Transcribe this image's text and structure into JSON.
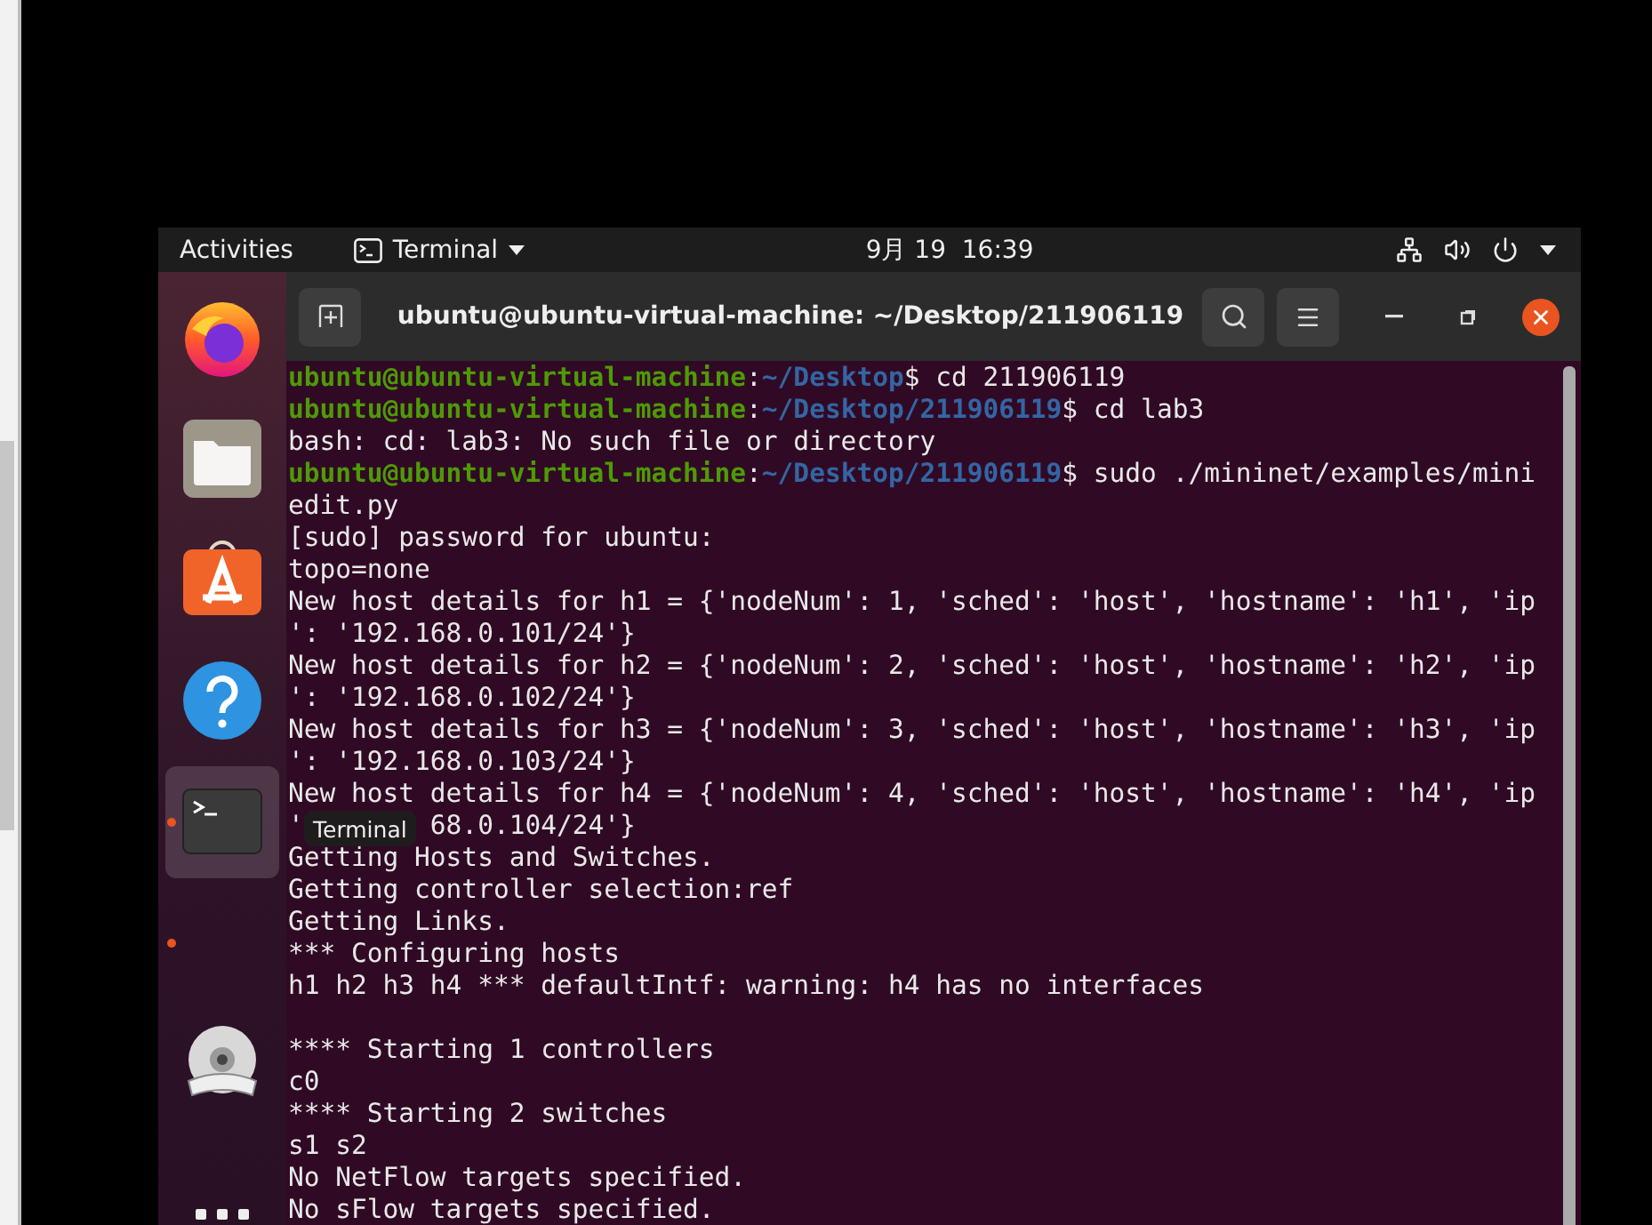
{
  "topbar": {
    "activities": "Activities",
    "app_menu": "Terminal",
    "clock": "9月 19  16:39"
  },
  "dock": {
    "items": [
      {
        "kind": "firefox",
        "running": false,
        "selected": false
      },
      {
        "kind": "files",
        "running": false,
        "selected": false
      },
      {
        "kind": "software",
        "running": false,
        "selected": false
      },
      {
        "kind": "help",
        "running": false,
        "selected": false
      },
      {
        "kind": "terminal",
        "running": true,
        "selected": true
      },
      {
        "kind": "empty",
        "running": true,
        "selected": false
      },
      {
        "kind": "dvd",
        "running": false,
        "selected": false
      }
    ],
    "tooltip": "Terminal"
  },
  "window": {
    "title": "ubuntu@ubuntu-virtual-machine: ~/Desktop/211906119"
  },
  "terminal": {
    "lines": [
      {
        "kind": "prompt",
        "user": "ubuntu@ubuntu-virtual-machine",
        "sep": ":",
        "path": "~/Desktop",
        "command": "$ cd 211906119"
      },
      {
        "kind": "prompt",
        "user": "ubuntu@ubuntu-virtual-machine",
        "sep": ":",
        "path": "~/Desktop/211906119",
        "command": "$ cd lab3"
      },
      {
        "kind": "output",
        "text": "bash: cd: lab3: No such file or directory"
      },
      {
        "kind": "prompt",
        "user": "ubuntu@ubuntu-virtual-machine",
        "sep": ":",
        "path": "~/Desktop/211906119",
        "command": "$ sudo ./mininet/examples/mini"
      },
      {
        "kind": "output",
        "text": "edit.py"
      },
      {
        "kind": "output",
        "text": "[sudo] password for ubuntu:"
      },
      {
        "kind": "output",
        "text": "topo=none"
      },
      {
        "kind": "output",
        "text": "New host details for h1 = {'nodeNum': 1, 'sched': 'host', 'hostname': 'h1', 'ip"
      },
      {
        "kind": "output",
        "text": "': '192.168.0.101/24'}"
      },
      {
        "kind": "output",
        "text": "New host details for h2 = {'nodeNum': 2, 'sched': 'host', 'hostname': 'h2', 'ip"
      },
      {
        "kind": "output",
        "text": "': '192.168.0.102/24'}"
      },
      {
        "kind": "output",
        "text": "New host details for h3 = {'nodeNum': 3, 'sched': 'host', 'hostname': 'h3', 'ip"
      },
      {
        "kind": "output",
        "text": "': '192.168.0.103/24'}"
      },
      {
        "kind": "output",
        "text": "New host details for h4 = {'nodeNum': 4, 'sched': 'host', 'hostname': 'h4', 'ip"
      },
      {
        "kind": "covered",
        "parts": [
          "'",
          "68.0.104/24'}"
        ]
      },
      {
        "kind": "output",
        "text": "Getting Hosts and Switches."
      },
      {
        "kind": "output",
        "text": "Getting controller selection:ref"
      },
      {
        "kind": "output",
        "text": "Getting Links."
      },
      {
        "kind": "output",
        "text": "*** Configuring hosts"
      },
      {
        "kind": "output",
        "text": "h1 h2 h3 h4 *** defaultIntf: warning: h4 has no interfaces"
      },
      {
        "kind": "output",
        "text": "**** Starting 1 controllers",
        "blank_before": true
      },
      {
        "kind": "output",
        "text": "c0"
      },
      {
        "kind": "output",
        "text": "**** Starting 2 switches"
      },
      {
        "kind": "output",
        "text": "s1 s2"
      },
      {
        "kind": "output",
        "text": "No NetFlow targets specified."
      },
      {
        "kind": "output",
        "text": "No sFlow targets specified."
      }
    ]
  }
}
